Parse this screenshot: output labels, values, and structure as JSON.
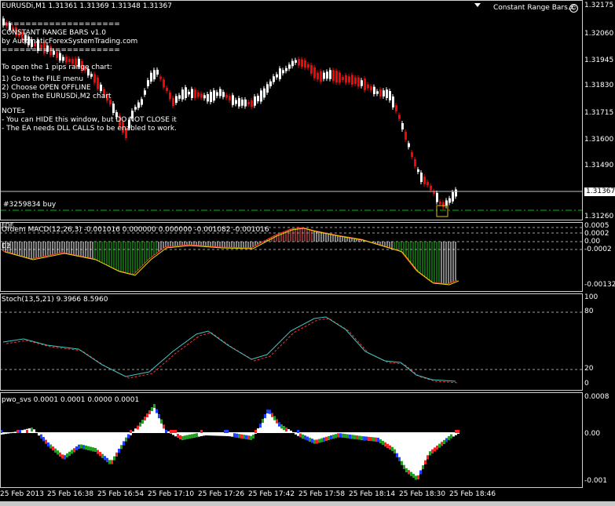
{
  "main": {
    "symbol_info": "EURUSDi,M1  1.31361 1.31369 1.31348 1.31367",
    "ea_name": "Constant Range Bars.x",
    "ea_icon": "smiley-icon",
    "info_lines": [
      "====================",
      "CONSTANT RANGE BARS v1.0",
      "by AutomaticForexSystemTrading.com",
      "====================",
      "",
      "To open the 1 pips range chart:",
      "",
      "1) Go to the FILE menu",
      "2) Choose OPEN OFFLINE",
      "3) Open the EURUSDi,M2 chart",
      "",
      "NOTEs",
      " - You can HIDE this window, but DO NOT CLOSE it",
      " - The EA needs DLL CALLS to be enabled to work."
    ],
    "order_label": "#3259834 buy",
    "current_price": "1.31367",
    "price_axis": [
      "1.32175",
      "1.32060",
      "1.31945",
      "1.31830",
      "1.31715",
      "1.31600",
      "1.31490",
      "1.31260"
    ],
    "colors": {
      "bull": "#ffffff",
      "bear": "#ff0000",
      "bg": "#000000",
      "grid": "#c0c0c0",
      "order_line": "#00c000"
    }
  },
  "macd": {
    "label": "Ordem MACD(12,26,3) -0.001016 0.000000 0.000000 -0.001082 -0.001016",
    "tag1": "FDF",
    "tag2": "D2",
    "axis": [
      "0.0005",
      "0.0002",
      "0.00",
      "-0.0002",
      "-0.00132"
    ]
  },
  "stoch": {
    "label": "Stoch(13,5,21) 9.3966 8.5960",
    "axis": [
      "100",
      "80",
      "20",
      "0"
    ],
    "colors": {
      "main": "#40c8c8",
      "signal": "#ff3030"
    }
  },
  "pwo": {
    "label": "pwo_svs 0.0001 0.0001 0.0000 0.0001",
    "axis": [
      "0.0008",
      "0.00",
      "-0.001"
    ]
  },
  "time_axis": [
    "25 Feb 2013",
    "25 Feb 16:38",
    "25 Feb 16:54",
    "25 Feb 17:10",
    "25 Feb 17:26",
    "25 Feb 17:42",
    "25 Feb 17:58",
    "25 Feb 18:14",
    "25 Feb 18:30",
    "25 Feb 18:46"
  ]
}
